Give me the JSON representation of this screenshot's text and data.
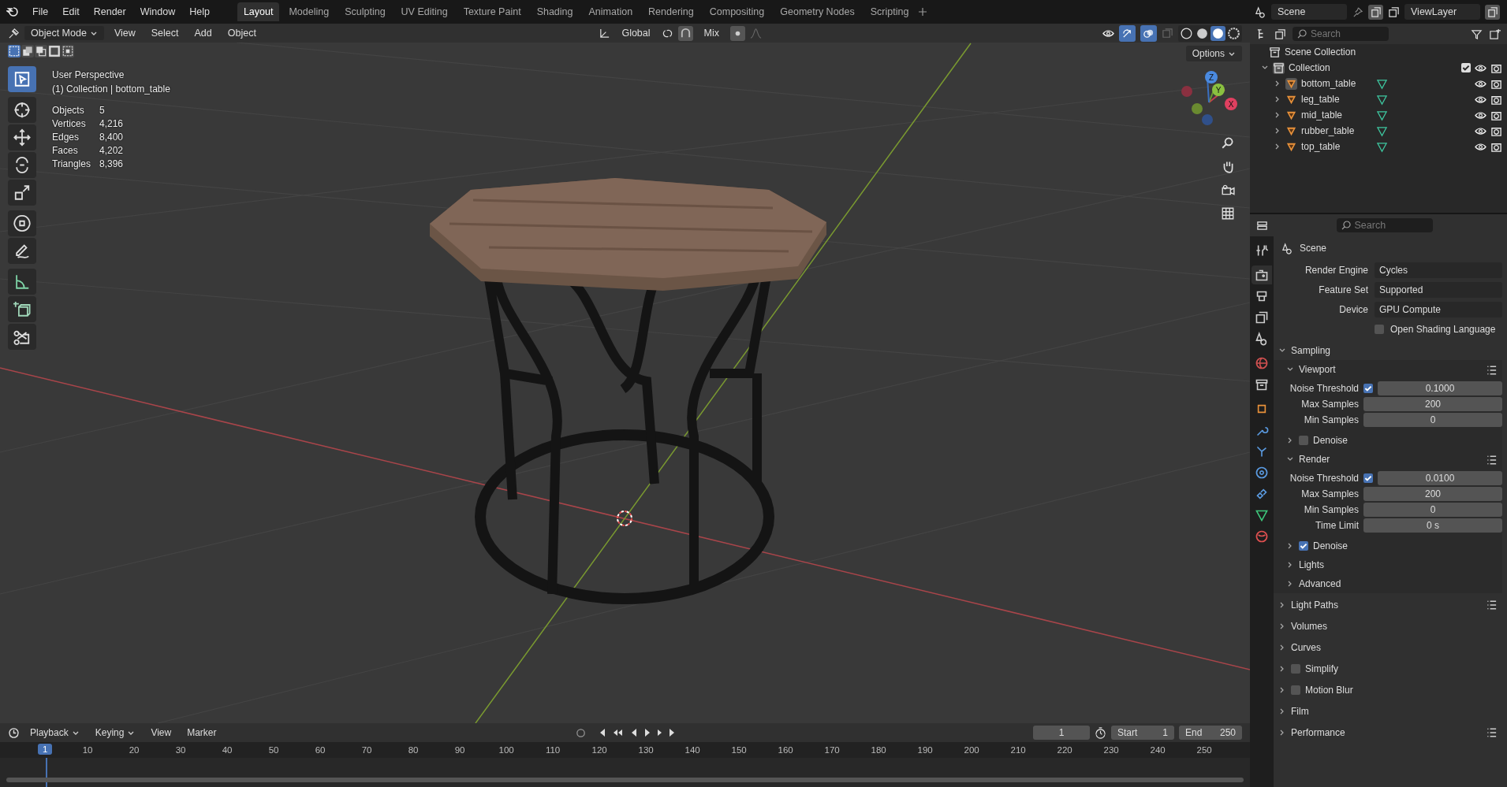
{
  "menu": [
    "File",
    "Edit",
    "Render",
    "Window",
    "Help"
  ],
  "workspaces": [
    {
      "label": "Layout",
      "selected": true
    },
    {
      "label": "Modeling",
      "selected": false
    },
    {
      "label": "Sculpting",
      "selected": false
    },
    {
      "label": "UV Editing",
      "selected": false
    },
    {
      "label": "Texture Paint",
      "selected": false
    },
    {
      "label": "Shading",
      "selected": false
    },
    {
      "label": "Animation",
      "selected": false
    },
    {
      "label": "Rendering",
      "selected": false
    },
    {
      "label": "Compositing",
      "selected": false
    },
    {
      "label": "Geometry Nodes",
      "selected": false
    },
    {
      "label": "Scripting",
      "selected": false
    }
  ],
  "scene_selector": "Scene",
  "view_layer": "ViewLayer",
  "viewport_header": {
    "mode": "Object Mode",
    "menus": [
      "View",
      "Select",
      "Add",
      "Object"
    ],
    "orientation": "Global",
    "snap": "Mix",
    "options": "Options",
    "shading": [
      {
        "kind": "wireframe",
        "selected": false
      },
      {
        "kind": "solid",
        "selected": false
      },
      {
        "kind": "material",
        "selected": true
      },
      {
        "kind": "rendered",
        "selected": false
      }
    ]
  },
  "viewport": {
    "title": "User Perspective",
    "subtitle": "(1) Collection | bottom_table",
    "stats": [
      {
        "label": "Objects",
        "value": "5"
      },
      {
        "label": "Vertices",
        "value": "4,216"
      },
      {
        "label": "Edges",
        "value": "8,400"
      },
      {
        "label": "Faces",
        "value": "4,202"
      },
      {
        "label": "Triangles",
        "value": "8,396"
      }
    ],
    "tools": [
      {
        "kind": "select",
        "selected": true
      },
      {
        "kind": "cursor",
        "selected": false
      },
      {
        "kind": "move",
        "selected": false
      },
      {
        "kind": "rotate",
        "selected": false
      },
      {
        "kind": "scale",
        "selected": false
      },
      {
        "kind": "transform",
        "selected": false
      },
      {
        "kind": "annotate",
        "selected": false
      },
      {
        "kind": "measure",
        "selected": false
      },
      {
        "kind": "add_cube",
        "selected": false
      },
      {
        "kind": "cut",
        "selected": false
      }
    ],
    "gizmo": [
      "X",
      "Y",
      "Z"
    ]
  },
  "outliner": {
    "search_placeholder": "Search",
    "root": "Scene Collection",
    "collection": {
      "label": "Collection",
      "expanded": true,
      "checked": true,
      "children": [
        {
          "label": "bottom_table",
          "selected": true
        },
        {
          "label": "leg_table",
          "selected": false
        },
        {
          "label": "mid_table",
          "selected": false
        },
        {
          "label": "rubber_table",
          "selected": false
        },
        {
          "label": "top_table",
          "selected": false
        }
      ]
    }
  },
  "properties": {
    "search_placeholder": "Search",
    "context": "Scene",
    "tabs": [
      {
        "kind": "tool",
        "selected": false
      },
      {
        "kind": "render",
        "selected": true
      },
      {
        "kind": "output",
        "selected": false
      },
      {
        "kind": "view_layer",
        "selected": false
      },
      {
        "kind": "scene",
        "selected": false
      },
      {
        "kind": "world",
        "selected": false
      },
      {
        "kind": "collection",
        "selected": false
      },
      {
        "kind": "object",
        "selected": false
      },
      {
        "kind": "modifier",
        "selected": false
      },
      {
        "kind": "particles",
        "selected": false
      },
      {
        "kind": "physics",
        "selected": false
      },
      {
        "kind": "constraints",
        "selected": false
      },
      {
        "kind": "data",
        "selected": false
      },
      {
        "kind": "material",
        "selected": false
      }
    ],
    "fields": [
      {
        "label": "Render Engine",
        "value": "Cycles"
      },
      {
        "label": "Feature Set",
        "value": "Supported"
      },
      {
        "label": "Device",
        "value": "GPU Compute"
      }
    ],
    "osl": {
      "label": "Open Shading Language",
      "checked": false
    },
    "panels": [
      {
        "label": "Sampling",
        "expanded": true,
        "presets": false,
        "subpanels": [
          {
            "label": "Viewport",
            "expanded": true,
            "presets": true,
            "rows": [
              {
                "label": "Noise Threshold",
                "value": "0.1000",
                "checked": true
              },
              {
                "label": "Max Samples",
                "value": "200"
              },
              {
                "label": "Min Samples",
                "value": "0"
              }
            ]
          },
          {
            "label": "Denoise",
            "expanded": false,
            "presets": false,
            "checked": false
          },
          {
            "label": "Render",
            "expanded": true,
            "presets": true,
            "rows": [
              {
                "label": "Noise Threshold",
                "value": "0.0100",
                "checked": true
              },
              {
                "label": "Max Samples",
                "value": "200"
              },
              {
                "label": "Min Samples",
                "value": "0"
              },
              {
                "label": "Time Limit",
                "value": "0 s"
              }
            ]
          },
          {
            "label": "Denoise",
            "expanded": false,
            "presets": false,
            "checked": true
          },
          {
            "label": "Lights",
            "expanded": false,
            "presets": false
          },
          {
            "label": "Advanced",
            "expanded": false,
            "presets": false
          }
        ]
      },
      {
        "label": "Light Paths",
        "expanded": false,
        "presets": true
      },
      {
        "label": "Volumes",
        "expanded": false,
        "presets": false
      },
      {
        "label": "Curves",
        "expanded": false,
        "presets": false
      },
      {
        "label": "Simplify",
        "expanded": false,
        "presets": false,
        "checked": false
      },
      {
        "label": "Motion Blur",
        "expanded": false,
        "presets": false,
        "checked": false
      },
      {
        "label": "Film",
        "expanded": false,
        "presets": false
      },
      {
        "label": "Performance",
        "expanded": false,
        "presets": true
      }
    ]
  },
  "timeline": {
    "menus": [
      "Playback",
      "Keying",
      "View",
      "Marker"
    ],
    "frame_field": "1",
    "start_label": "Start",
    "start": "1",
    "end_label": "End",
    "end": "250",
    "playhead": "1",
    "ticks": [
      "10",
      "20",
      "30",
      "40",
      "50",
      "60",
      "70",
      "80",
      "90",
      "100",
      "110",
      "120",
      "130",
      "140",
      "150",
      "160",
      "170",
      "180",
      "190",
      "200",
      "210",
      "220",
      "230",
      "240",
      "250"
    ]
  }
}
